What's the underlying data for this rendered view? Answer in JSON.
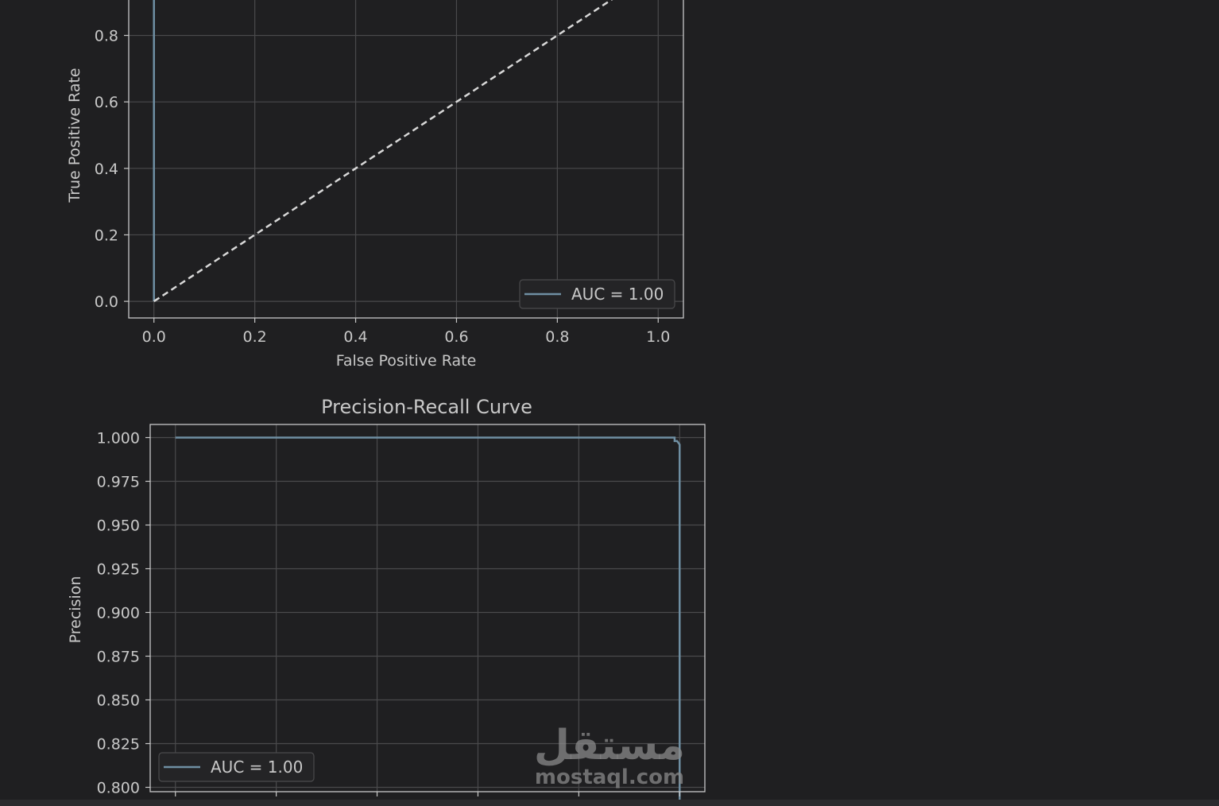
{
  "colors": {
    "background": "#1f1f21",
    "axes_frame": "#c8c8c8",
    "grid": "#4a4a4c",
    "text": "#c8c8c8",
    "series": "#6f8fa3",
    "diagonal": "#d8d8d8",
    "legend_bg": "#242426",
    "legend_border": "#4a4a4c",
    "watermark": "#8a8a8a"
  },
  "chart_data": [
    {
      "type": "line",
      "title": "",
      "xlabel": "False Positive Rate",
      "ylabel": "True Positive Rate",
      "xlim": [
        -0.05,
        1.05
      ],
      "ylim": [
        -0.05,
        1.05
      ],
      "xticks": [
        "0.0",
        "0.2",
        "0.4",
        "0.6",
        "0.8",
        "1.0"
      ],
      "yticks": [
        "0.0",
        "0.2",
        "0.4",
        "0.6",
        "0.8"
      ],
      "grid": true,
      "legend_position": "lower right",
      "series": [
        {
          "name": "AUC = 1.00",
          "x": [
            0,
            0,
            0
          ],
          "y": [
            0,
            0.9,
            1.0
          ],
          "style": "solid"
        },
        {
          "x": [
            0,
            1
          ],
          "y": [
            0,
            1
          ],
          "style": "dashed"
        }
      ]
    },
    {
      "type": "line",
      "title": "Precision-Recall Curve",
      "xlabel": "",
      "ylabel": "Precision",
      "xlim": [
        -0.05,
        1.05
      ],
      "ylim": [
        0.7975,
        1.0075
      ],
      "xticks": [
        "",
        "",
        "",
        "",
        "",
        ""
      ],
      "yticks": [
        "0.800",
        "0.825",
        "0.850",
        "0.875",
        "0.900",
        "0.925",
        "0.950",
        "0.975",
        "1.000"
      ],
      "grid": true,
      "legend_position": "lower left",
      "series": [
        {
          "name": "AUC = 1.00",
          "x": [
            0,
            0.985,
            0.99,
            0.99,
            0.995,
            1.0,
            1.0,
            1.0
          ],
          "y": [
            1.0,
            1.0,
            1.0,
            0.998,
            0.998,
            0.996,
            0.99,
            0.79
          ],
          "style": "solid"
        }
      ]
    }
  ],
  "watermark": {
    "arabic": "مستقل",
    "latin": "mostaql.com"
  }
}
